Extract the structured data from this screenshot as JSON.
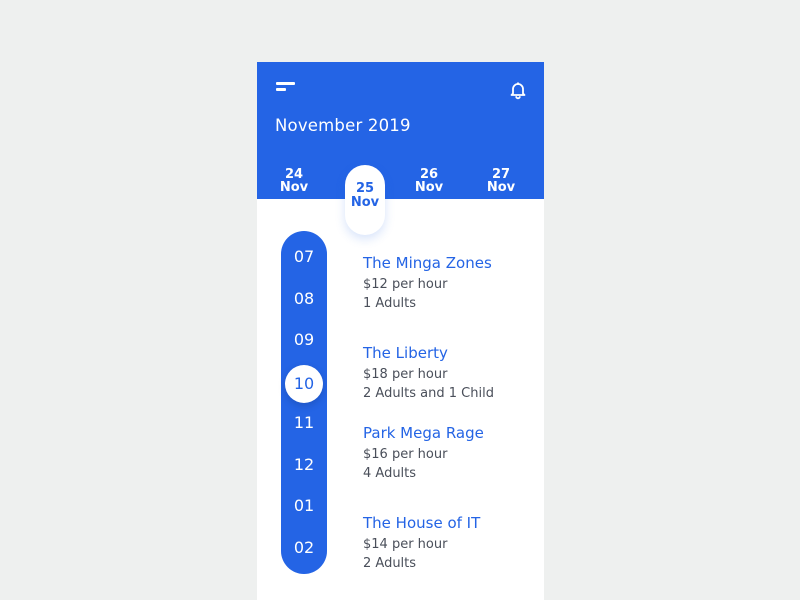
{
  "header": {
    "month": "November 2019",
    "days": [
      {
        "num": "24",
        "mon": "Nov"
      },
      {
        "num": "25",
        "mon": "Nov"
      },
      {
        "num": "26",
        "mon": "Nov"
      },
      {
        "num": "27",
        "mon": "Nov"
      }
    ],
    "selected_day_index": 1
  },
  "timeline": {
    "hours": [
      "07",
      "08",
      "09",
      "10",
      "11",
      "12",
      "01",
      "02"
    ],
    "selected_hour": "10"
  },
  "bookings": [
    {
      "name": "The Minga Zones",
      "price": "$12 per hour",
      "guests": "1 Adults"
    },
    {
      "name": "The Liberty",
      "price": "$18 per hour",
      "guests": "2 Adults and 1 Child"
    },
    {
      "name": "Park Mega Rage",
      "price": "$16 per hour",
      "guests": "4 Adults"
    },
    {
      "name": "The House of IT",
      "price": "$14 per hour",
      "guests": "2 Adults"
    }
  ],
  "colors": {
    "accent": "#2464e5",
    "background": "#eef0ef",
    "card": "#ffffff",
    "text_secondary": "#4a4f5a"
  },
  "icons": {
    "menu": "menu-icon",
    "notifications": "bell-icon"
  }
}
